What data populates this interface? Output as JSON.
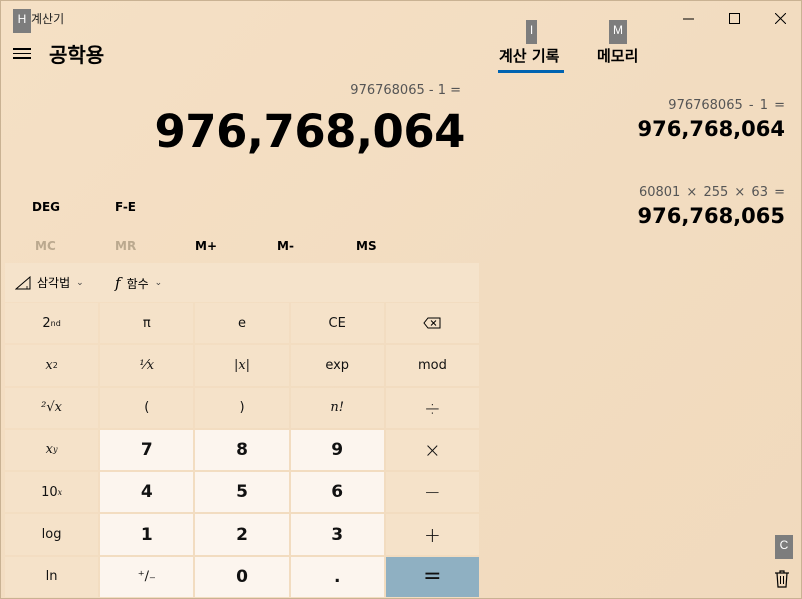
{
  "window": {
    "title": "계산기",
    "hint_h": "H",
    "hint_i": "I",
    "hint_m": "M",
    "hint_c": "C"
  },
  "header": {
    "mode_title": "공학용"
  },
  "tabs": [
    {
      "label": "계산 기록",
      "active": true
    },
    {
      "label": "메모리",
      "active": false
    }
  ],
  "display": {
    "expression": "976768065 - 1 =",
    "result": "976,768,064"
  },
  "modes": {
    "angle": "DEG",
    "fe": "F-E"
  },
  "memory": [
    "MC",
    "MR",
    "M+",
    "M-",
    "MS"
  ],
  "dropdowns": {
    "trig": "삼각법",
    "func": "함수"
  },
  "keys": {
    "second": "2",
    "second_sup": "nd",
    "pi": "π",
    "e": "e",
    "ce": "CE",
    "x_sq": "x",
    "x_sq_sup": "2",
    "recip": "¹⁄x",
    "abs": "|x|",
    "exp": "exp",
    "mod": "mod",
    "sqrt": "²√x",
    "lparen": "(",
    "rparen": ")",
    "fact": "n!",
    "divide": "÷",
    "x_pow": "x",
    "x_pow_sup": "y",
    "seven": "7",
    "eight": "8",
    "nine": "9",
    "multiply": "×",
    "ten_pow": "10",
    "ten_pow_sup": "x",
    "four": "4",
    "five": "5",
    "six": "6",
    "minus": "−",
    "log": "log",
    "one": "1",
    "two": "2",
    "three": "3",
    "plus": "+",
    "ln": "ln",
    "negate": "⁺∕₋",
    "zero": "0",
    "dot": ".",
    "equals": "="
  },
  "history": [
    {
      "expression": "976768065   -   1 =",
      "result": "976,768,064"
    },
    {
      "expression": "60801   ×   255   ×   63 =",
      "result": "976,768,065"
    }
  ]
}
